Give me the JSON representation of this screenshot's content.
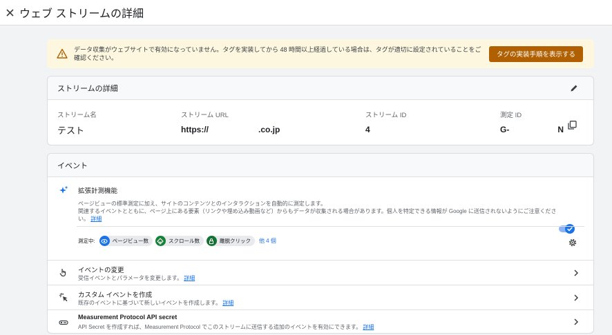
{
  "header": {
    "title": "ウェブ ストリームの詳細"
  },
  "alert": {
    "text": "データ収集がウェブサイトで有効になっていません。タグを実装してから 48 時間以上経過している場合は、タグが適切に設定されていることをご確認ください。",
    "button_label": "タグの実装手順を表示する"
  },
  "stream_details": {
    "heading": "ストリームの詳細",
    "name_label": "ストリーム名",
    "name_value": "テスト",
    "url_label": "ストリーム URL",
    "url_prefix": "https://",
    "url_suffix": ".co.jp",
    "id_label": "ストリーム ID",
    "id_value": "4",
    "measurement_label": "測定 ID",
    "measurement_prefix": "G-",
    "measurement_suffix": "N"
  },
  "events": {
    "heading": "イベント",
    "enhanced": {
      "title": "拡張計測機能",
      "desc1": "ページビューの標準測定に加え、サイトのコンテンツとのインタラクションを自動的に測定します。",
      "desc2": "関連するイベントとともに、ページ上にある要素（リンクや埋め込み動画など）からもデータが収集される場合があります。個人を特定できる情報が Google に送信されないようにご注意ください。",
      "desc_link": "詳細",
      "measuring_label": "測定中:",
      "chips": [
        "ページビュー数",
        "スクロール数",
        "離脱クリック"
      ],
      "more_label": "他 4 個",
      "enabled": true
    },
    "rows": [
      {
        "title": "イベントの変更",
        "desc": "受信イベントとパラメータを変更します。",
        "link": "詳細"
      },
      {
        "title": "カスタム イベントを作成",
        "desc": "既存のイベントに基づいて新しいイベントを作成します。",
        "link": "詳細"
      },
      {
        "title": "Measurement Protocol API secret",
        "desc": "API Secret を作成すれば、Measurement Protocol でこのストリームに送信する追加のイベントを有効にできます。",
        "link": "詳細"
      }
    ]
  },
  "colors": {
    "accent": "#1a73e8",
    "warning_button": "#b06000",
    "warning_bg": "#fef7e0"
  }
}
